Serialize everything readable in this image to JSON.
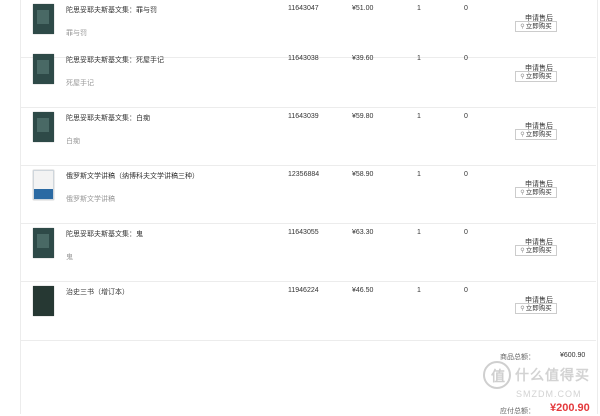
{
  "rows": [
    {
      "title": "陀思妥耶夫斯基文集：罪与罚",
      "subtitle": "罪与罚",
      "sku": "11643047",
      "price": "¥51.00",
      "qty": "1",
      "extra": "0",
      "refund_label": "申请售后",
      "buy_label": "立即购买"
    },
    {
      "title": "陀思妥耶夫斯基文集：死屋手记",
      "subtitle": "死屋手记",
      "sku": "11643038",
      "price": "¥39.60",
      "qty": "1",
      "extra": "0",
      "refund_label": "申请售后",
      "buy_label": "立即购买"
    },
    {
      "title": "陀思妥耶夫斯基文集：白痴",
      "subtitle": "白痴",
      "sku": "11643039",
      "price": "¥59.80",
      "qty": "1",
      "extra": "0",
      "refund_label": "申请售后",
      "buy_label": "立即购买"
    },
    {
      "title": "俄罗斯文学讲稿（纳博科夫文学讲稿三种）",
      "subtitle": "俄罗斯文学讲稿",
      "sku": "12356884",
      "price": "¥58.90",
      "qty": "1",
      "extra": "0",
      "refund_label": "申请售后",
      "buy_label": "立即购买"
    },
    {
      "title": "陀思妥耶夫斯基文集：鬼",
      "subtitle": "鬼",
      "sku": "11643055",
      "price": "¥63.30",
      "qty": "1",
      "extra": "0",
      "refund_label": "申请售后",
      "buy_label": "立即购买"
    },
    {
      "title": "治史三书（增订本）",
      "subtitle": "",
      "sku": "11946224",
      "price": "¥46.50",
      "qty": "1",
      "extra": "0",
      "refund_label": "申请售后",
      "buy_label": "立即购买"
    }
  ],
  "totals": {
    "goods_label": "商品总额：",
    "goods_value": "¥600.90",
    "due_label": "应付总额：",
    "due_value": "¥200.90"
  },
  "watermark": {
    "glyph": "值",
    "text": "什么值得买",
    "url": "SMZDM.COM"
  }
}
